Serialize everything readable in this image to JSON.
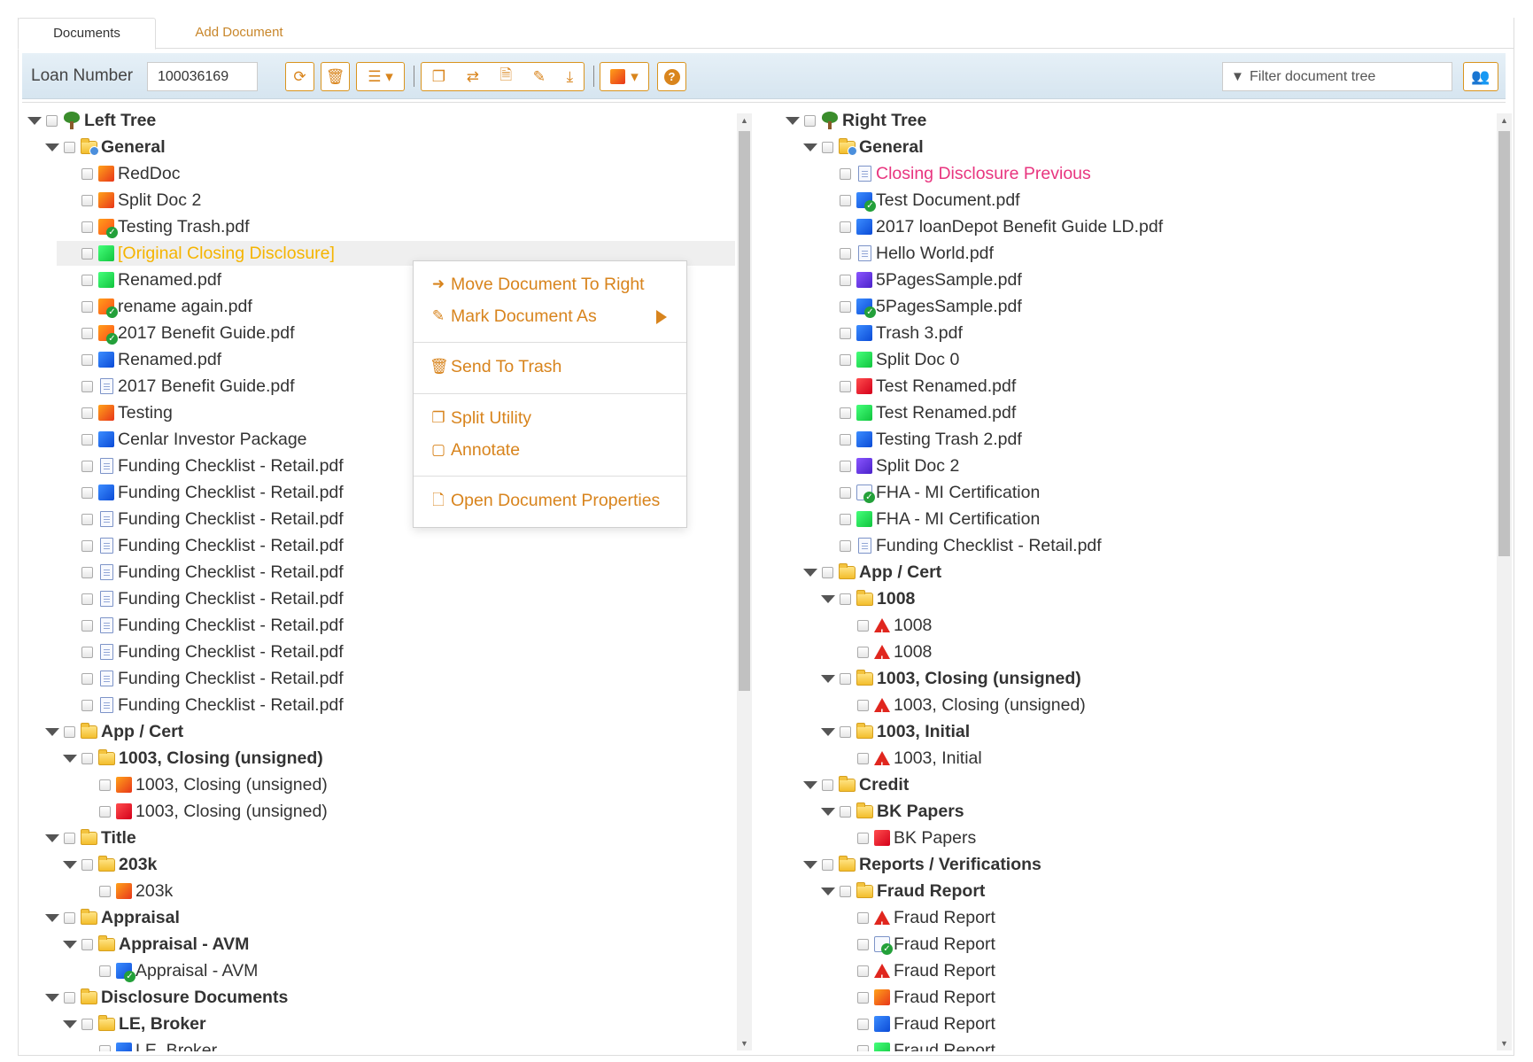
{
  "tabs": {
    "documents": "Documents",
    "add_document": "Add Document"
  },
  "toolbar": {
    "loan_label": "Loan Number",
    "loan_value": "100036169",
    "filter_placeholder": "Filter document tree"
  },
  "left_tree": {
    "nodes": [
      {
        "label": "Left Tree",
        "type": "root",
        "level": 0
      },
      {
        "label": "General",
        "type": "folder-gen",
        "level": 1
      },
      {
        "label": "RedDoc",
        "icon": "orange",
        "level": 2
      },
      {
        "label": "Split Doc 2",
        "icon": "orange",
        "level": 2
      },
      {
        "label": "Testing Trash.pdf",
        "icon": "check",
        "level": 2
      },
      {
        "label": "[Original Closing Disclosure]",
        "icon": "green",
        "level": 2,
        "selected": true
      },
      {
        "label": "Renamed.pdf",
        "icon": "green",
        "level": 2
      },
      {
        "label": "rename again.pdf",
        "icon": "check",
        "level": 2
      },
      {
        "label": "2017 Benefit Guide.pdf",
        "icon": "check",
        "level": 2
      },
      {
        "label": "Renamed.pdf",
        "icon": "blue",
        "level": 2
      },
      {
        "label": "2017 Benefit Guide.pdf",
        "icon": "doc",
        "level": 2
      },
      {
        "label": "Testing",
        "icon": "orange",
        "level": 2
      },
      {
        "label": "Cenlar Investor Package",
        "icon": "blue",
        "level": 2
      },
      {
        "label": "Funding Checklist - Retail.pdf",
        "icon": "doc",
        "level": 2
      },
      {
        "label": "Funding Checklist - Retail.pdf",
        "icon": "blue",
        "level": 2
      },
      {
        "label": "Funding Checklist - Retail.pdf",
        "icon": "doc",
        "level": 2
      },
      {
        "label": "Funding Checklist - Retail.pdf",
        "icon": "doc",
        "level": 2
      },
      {
        "label": "Funding Checklist - Retail.pdf",
        "icon": "doc",
        "level": 2
      },
      {
        "label": "Funding Checklist - Retail.pdf",
        "icon": "doc",
        "level": 2
      },
      {
        "label": "Funding Checklist - Retail.pdf",
        "icon": "doc",
        "level": 2
      },
      {
        "label": "Funding Checklist - Retail.pdf",
        "icon": "doc",
        "level": 2
      },
      {
        "label": "Funding Checklist - Retail.pdf",
        "icon": "doc",
        "level": 2
      },
      {
        "label": "Funding Checklist - Retail.pdf",
        "icon": "doc",
        "level": 2
      },
      {
        "label": "App / Cert",
        "type": "folder",
        "level": 1
      },
      {
        "label": "1003, Closing (unsigned)",
        "type": "folder",
        "level": 2
      },
      {
        "label": "1003, Closing (unsigned)",
        "icon": "orange",
        "level": 3
      },
      {
        "label": "1003, Closing (unsigned)",
        "icon": "red",
        "level": 3
      },
      {
        "label": "Title",
        "type": "folder",
        "level": 1
      },
      {
        "label": "203k",
        "type": "folder",
        "level": 2
      },
      {
        "label": "203k",
        "icon": "orange",
        "level": 3
      },
      {
        "label": "Appraisal",
        "type": "folder",
        "level": 1
      },
      {
        "label": "Appraisal - AVM",
        "type": "folder",
        "level": 2
      },
      {
        "label": "Appraisal - AVM",
        "icon": "check-b",
        "level": 3
      },
      {
        "label": "Disclosure Documents",
        "type": "folder",
        "level": 1
      },
      {
        "label": "LE, Broker",
        "type": "folder",
        "level": 2
      },
      {
        "label": "LE, Broker",
        "icon": "blue",
        "level": 3
      }
    ]
  },
  "right_tree": {
    "nodes": [
      {
        "label": "Right Tree",
        "type": "root",
        "level": 0
      },
      {
        "label": "General",
        "type": "folder-gen",
        "level": 1
      },
      {
        "label": "Closing Disclosure Previous",
        "icon": "doc",
        "level": 2,
        "pink": true
      },
      {
        "label": "Test Document.pdf",
        "icon": "check-b",
        "level": 2
      },
      {
        "label": "2017 loanDepot Benefit Guide LD.pdf",
        "icon": "blue",
        "level": 2
      },
      {
        "label": "Hello World.pdf",
        "icon": "doc",
        "level": 2
      },
      {
        "label": "5PagesSample.pdf",
        "icon": "purple",
        "level": 2
      },
      {
        "label": "5PagesSample.pdf",
        "icon": "check-b",
        "level": 2
      },
      {
        "label": "Trash 3.pdf",
        "icon": "blue",
        "level": 2
      },
      {
        "label": "Split Doc 0",
        "icon": "green",
        "level": 2
      },
      {
        "label": "Test Renamed.pdf",
        "icon": "red",
        "level": 2
      },
      {
        "label": "Test Renamed.pdf",
        "icon": "green",
        "level": 2
      },
      {
        "label": "Testing Trash 2.pdf",
        "icon": "blue",
        "level": 2
      },
      {
        "label": "Split Doc 2",
        "icon": "purple",
        "level": 2
      },
      {
        "label": "FHA - MI Certification",
        "icon": "check-d",
        "level": 2
      },
      {
        "label": "FHA - MI Certification",
        "icon": "green",
        "level": 2
      },
      {
        "label": "Funding Checklist - Retail.pdf",
        "icon": "doc",
        "level": 2
      },
      {
        "label": "App / Cert",
        "type": "folder",
        "level": 1
      },
      {
        "label": "1008",
        "type": "folder",
        "level": 2
      },
      {
        "label": "1008",
        "icon": "warn",
        "level": 3
      },
      {
        "label": "1008",
        "icon": "warn",
        "level": 3
      },
      {
        "label": "1003, Closing (unsigned)",
        "type": "folder",
        "level": 2
      },
      {
        "label": "1003, Closing (unsigned)",
        "icon": "warn",
        "level": 3
      },
      {
        "label": "1003, Initial",
        "type": "folder",
        "level": 2
      },
      {
        "label": "1003, Initial",
        "icon": "warn",
        "level": 3
      },
      {
        "label": "Credit",
        "type": "folder",
        "level": 1
      },
      {
        "label": "BK Papers",
        "type": "folder",
        "level": 2
      },
      {
        "label": "BK Papers",
        "icon": "red",
        "level": 3
      },
      {
        "label": "Reports / Verifications",
        "type": "folder",
        "level": 1
      },
      {
        "label": "Fraud Report",
        "type": "folder",
        "level": 2
      },
      {
        "label": "Fraud Report",
        "icon": "warn",
        "level": 3
      },
      {
        "label": "Fraud Report",
        "icon": "check-d",
        "level": 3
      },
      {
        "label": "Fraud Report",
        "icon": "warn",
        "level": 3
      },
      {
        "label": "Fraud Report",
        "icon": "orange",
        "level": 3
      },
      {
        "label": "Fraud Report",
        "icon": "blue",
        "level": 3
      },
      {
        "label": "Fraud Report",
        "icon": "green",
        "level": 3
      }
    ]
  },
  "context_menu": {
    "move_right": "Move Document To Right",
    "mark_as": "Mark Document As",
    "send_trash": "Send To Trash",
    "split_utility": "Split Utility",
    "annotate": "Annotate",
    "open_properties": "Open Document Properties"
  },
  "colors": {
    "accent": "#d9851d",
    "selected": "#f5b400",
    "pink": "#e8357f"
  }
}
